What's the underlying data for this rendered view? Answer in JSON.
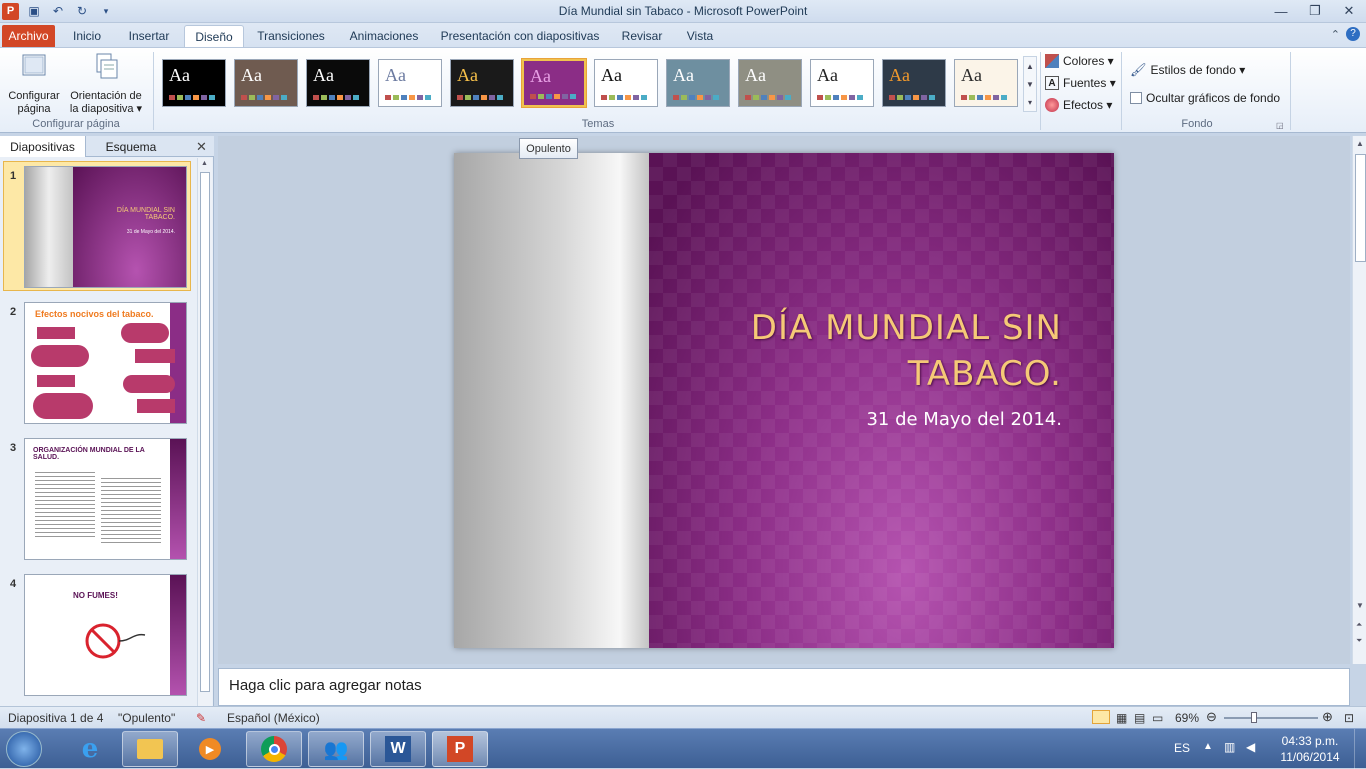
{
  "window": {
    "title": "Día Mundial sin Tabaco  -  Microsoft PowerPoint"
  },
  "tabs": [
    {
      "label": "Archivo"
    },
    {
      "label": "Inicio"
    },
    {
      "label": "Insertar"
    },
    {
      "label": "Diseño"
    },
    {
      "label": "Transiciones"
    },
    {
      "label": "Animaciones"
    },
    {
      "label": "Presentación con diapositivas"
    },
    {
      "label": "Revisar"
    },
    {
      "label": "Vista"
    }
  ],
  "ribbon": {
    "page_setup": {
      "configurar": "Configurar\npágina",
      "orientacion": "Orientación de\nla diapositiva ▾",
      "group": "Configurar página"
    },
    "themes_group": "Temas",
    "themes": [
      {
        "bg": "#000000",
        "fg": "#ffffff"
      },
      {
        "bg": "#6f5b50",
        "fg": "#ffffff"
      },
      {
        "bg": "#0a0a0a",
        "fg": "#ffffff"
      },
      {
        "bg": "#ffffff",
        "fg": "#6b7aa0"
      },
      {
        "bg": "#1a1a1a",
        "fg": "#f7c14a"
      },
      {
        "bg": "#8b2d86",
        "fg": "#e8a1e6"
      },
      {
        "bg": "#ffffff",
        "fg": "#111111"
      },
      {
        "bg": "#6e8fa0",
        "fg": "#ffffff"
      },
      {
        "bg": "#8f8f83",
        "fg": "#ffffff"
      },
      {
        "bg": "#ffffff",
        "fg": "#222222"
      },
      {
        "bg": "#2e3a48",
        "fg": "#f39a2c"
      },
      {
        "bg": "#fbf4e8",
        "fg": "#2a2a2a"
      }
    ],
    "colores": "Colores ▾",
    "fuentes": "Fuentes ▾",
    "efectos": "Efectos ▾",
    "estilos_fondo": "Estilos de fondo ▾",
    "ocultar": "Ocultar gráficos de fondo",
    "fondo_group": "Fondo"
  },
  "tooltip": "Opulento",
  "left_pane": {
    "tab_slides": "Diapositivas",
    "tab_outline": "Esquema",
    "slides": [
      {
        "num": "1",
        "title": "DÍA MUNDIAL SIN TABACO.",
        "sub": "31 de Mayo del 2014."
      },
      {
        "num": "2",
        "title": "Efectos nocivos del tabaco."
      },
      {
        "num": "3",
        "title": "ORGANIZACIÓN MUNDIAL DE LA SALUD."
      },
      {
        "num": "4",
        "title": "NO FUMES!"
      }
    ]
  },
  "slide": {
    "title_line1": "DÍA MUNDIAL SIN",
    "title_line2": "TABACO.",
    "subtitle": "31 de Mayo del 2014."
  },
  "notes": "Haga clic para agregar notas",
  "status": {
    "slide_of": "Diapositiva 1 de 4",
    "theme": "\"Opulento\"",
    "language": "Español (México)",
    "zoom": "69%"
  },
  "taskbar": {
    "language": "ES",
    "time": "04:33 p.m.",
    "date": "11/06/2014"
  }
}
